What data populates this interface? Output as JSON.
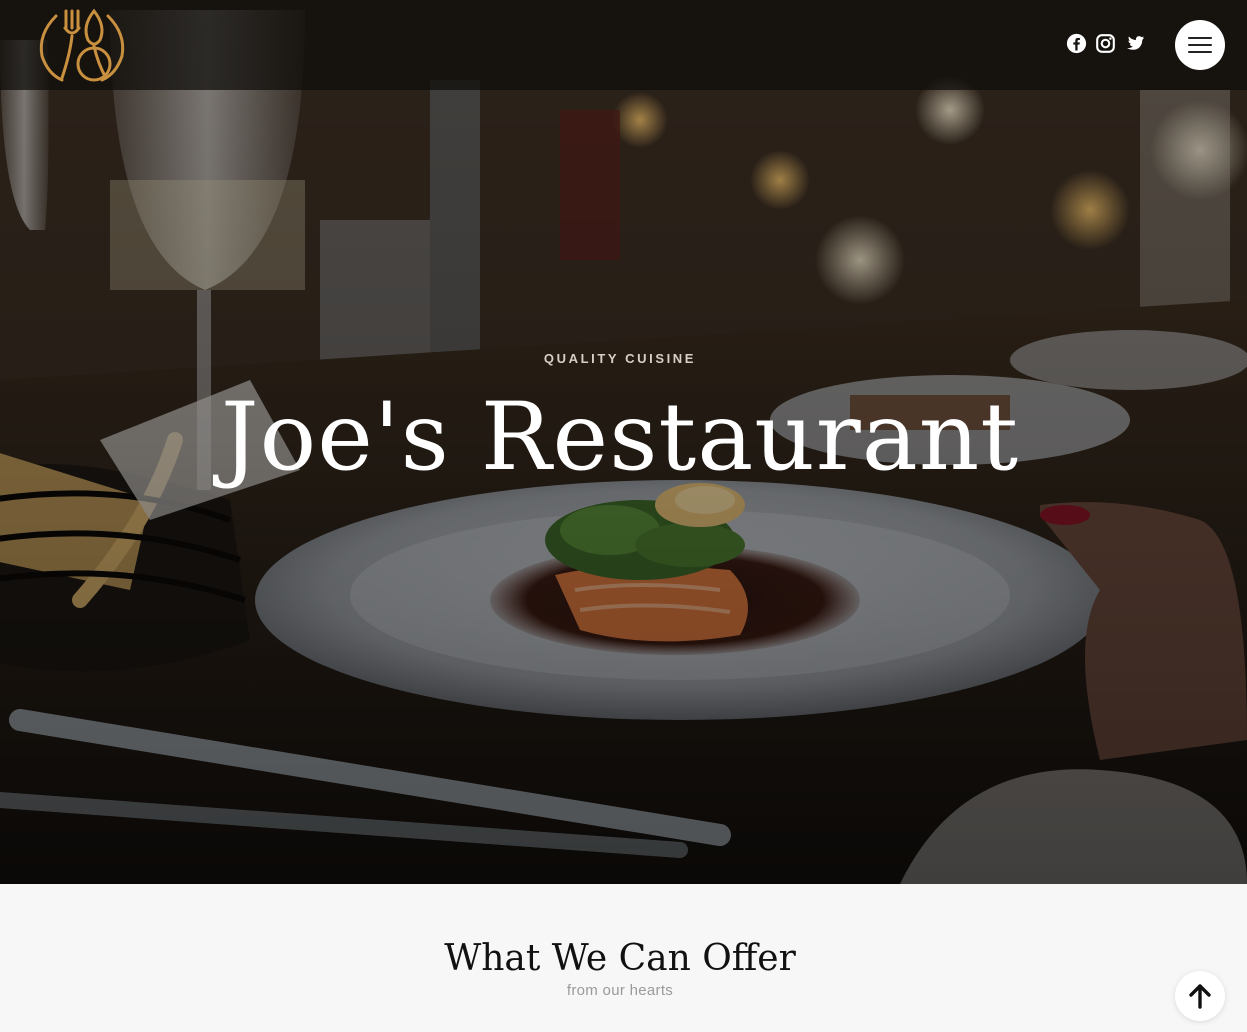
{
  "header": {
    "social_links": [
      {
        "name": "facebook",
        "icon": "facebook-icon"
      },
      {
        "name": "instagram",
        "icon": "instagram-icon"
      },
      {
        "name": "twitter",
        "icon": "twitter-icon"
      }
    ],
    "menu_icon": "hamburger-menu-icon",
    "logo_icon": "fork-spoon-logo"
  },
  "hero": {
    "eyebrow": "QUALITY CUISINE",
    "title": "Joe's Restaurant"
  },
  "offer": {
    "title": "What We Can Offer",
    "subtitle": "from our hearts"
  },
  "scroll_top": {
    "icon": "arrow-up-icon"
  },
  "colors": {
    "accent_gold": "#c9913f",
    "header_bg": "#0e0c0a",
    "section_bg": "#f7f7f7",
    "title_dark": "#111111",
    "subtitle_gray": "#9a9a9a"
  }
}
